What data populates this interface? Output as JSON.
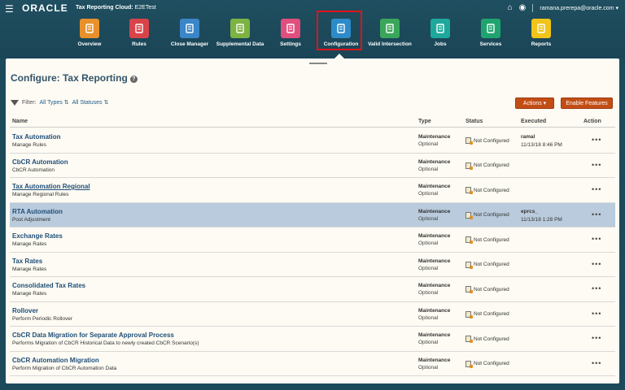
{
  "header": {
    "oracle_logo": "ORACLE",
    "app_label": "Tax Reporting Cloud:",
    "app_instance": "E2ETest",
    "user": "ramana.prerepa@oracle.com"
  },
  "nav": [
    {
      "label": "Overview",
      "color": "#e8912b",
      "icon": "overview-icon"
    },
    {
      "label": "Rules",
      "color": "#d9444a",
      "icon": "rules-icon"
    },
    {
      "label": "Close Manager",
      "color": "#3a86c8",
      "icon": "close-manager-icon"
    },
    {
      "label": "Supplemental Data",
      "color": "#7cb342",
      "icon": "supplemental-data-icon"
    },
    {
      "label": "Settings",
      "color": "#e04f7e",
      "icon": "settings-icon"
    },
    {
      "label": "Configuration",
      "color": "#2e8bc9",
      "icon": "configuration-icon"
    },
    {
      "label": "Valid Intersection",
      "color": "#3aa65a",
      "icon": "valid-intersection-icon"
    },
    {
      "label": "Jobs",
      "color": "#1ea89b",
      "icon": "jobs-icon"
    },
    {
      "label": "Services",
      "color": "#1fa46f",
      "icon": "services-icon"
    },
    {
      "label": "Reports",
      "color": "#f0c419",
      "icon": "reports-icon"
    }
  ],
  "page": {
    "title": "Configure: Tax Reporting",
    "filter_label": "Filter:",
    "filter_types": "All Types",
    "filter_statuses": "All Statuses",
    "actions_button": "Actions ▾",
    "enable_button": "Enable Features"
  },
  "columns": {
    "name": "Name",
    "type": "Type",
    "status": "Status",
    "executed": "Executed",
    "action": "Action"
  },
  "rows": [
    {
      "name": "Tax Automation",
      "sub": "Manage Rules",
      "type": "Maintenance",
      "req": "Optional",
      "status": "Not Configured",
      "exec1": "ramal",
      "exec2": "11/13/18 8:46 PM",
      "selected": false,
      "underline": false
    },
    {
      "name": "CbCR Automation",
      "sub": "CbCR Automation",
      "type": "Maintenance",
      "req": "Optional",
      "status": "Not Configured",
      "exec1": "",
      "exec2": "",
      "selected": false,
      "underline": false
    },
    {
      "name": "Tax Automation Regional",
      "sub": "Manage Regional Rules",
      "type": "Maintenance",
      "req": "Optional",
      "status": "Not Configured",
      "exec1": "",
      "exec2": "",
      "selected": false,
      "underline": true
    },
    {
      "name": "RTA Automation",
      "sub": "Post Adjustment",
      "type": "Maintenance",
      "req": "Optional",
      "status": "Not Configured",
      "exec1": "eprcs_",
      "exec2": "11/13/18 1:28 PM",
      "selected": true,
      "underline": false
    },
    {
      "name": "Exchange Rates",
      "sub": "Manage Rates",
      "type": "Maintenance",
      "req": "Optional",
      "status": "Not Configured",
      "exec1": "",
      "exec2": "",
      "selected": false,
      "underline": false
    },
    {
      "name": "Tax Rates",
      "sub": "Manage Rates",
      "type": "Maintenance",
      "req": "Optional",
      "status": "Not Configured",
      "exec1": "",
      "exec2": "",
      "selected": false,
      "underline": false
    },
    {
      "name": "Consolidated Tax Rates",
      "sub": "Manage Rates",
      "type": "Maintenance",
      "req": "Optional",
      "status": "Not Configured",
      "exec1": "",
      "exec2": "",
      "selected": false,
      "underline": false
    },
    {
      "name": "Rollover",
      "sub": "Perform Periodic Rollover",
      "type": "Maintenance",
      "req": "Optional",
      "status": "Not Configured",
      "exec1": "",
      "exec2": "",
      "selected": false,
      "underline": false
    },
    {
      "name": "CbCR Data Migration for Separate Approval Process",
      "sub": "Performs Migration of CbCR Historical Data to newly created CbCR Scenario(s)",
      "type": "Maintenance",
      "req": "Optional",
      "status": "Not Configured",
      "exec1": "",
      "exec2": "",
      "selected": false,
      "underline": false
    },
    {
      "name": "CbCR Automation Migration",
      "sub": "Perform Migration of CbCR Automation Data",
      "type": "Maintenance",
      "req": "Optional",
      "status": "Not Configured",
      "exec1": "",
      "exec2": "",
      "selected": false,
      "underline": false
    }
  ]
}
